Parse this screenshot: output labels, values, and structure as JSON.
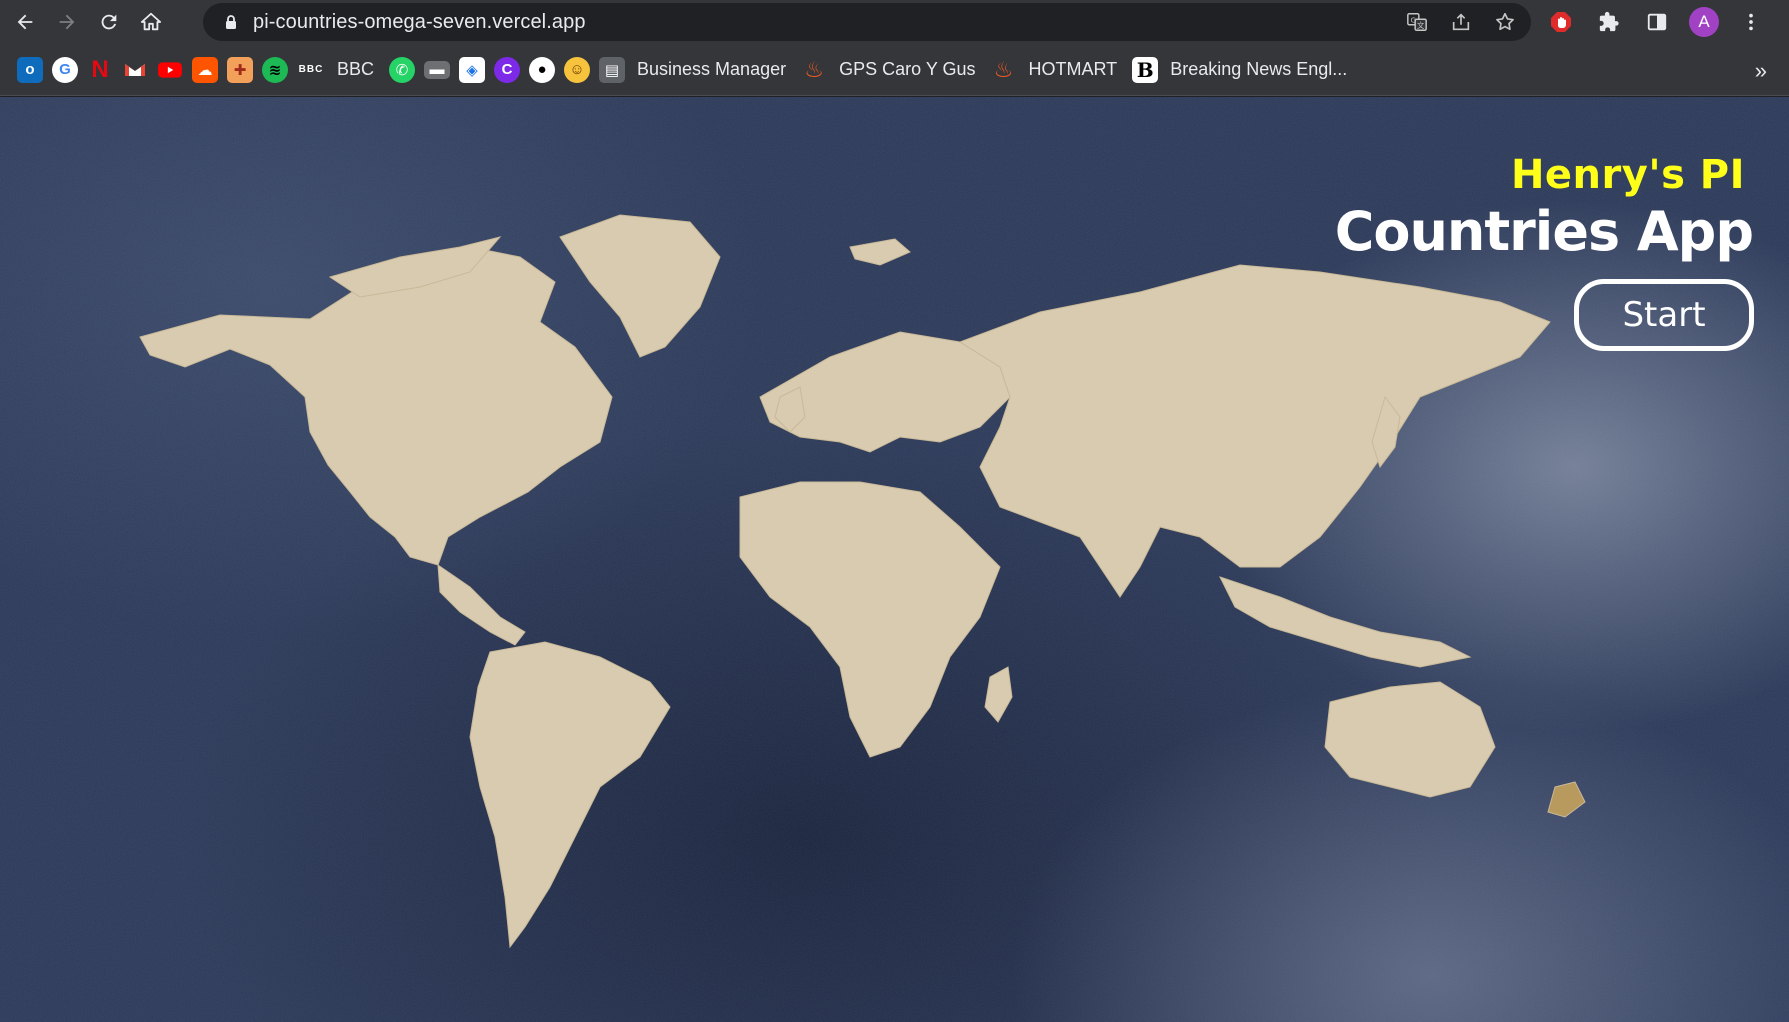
{
  "browser": {
    "url": "pi-countries-omega-seven.vercel.app",
    "avatar_letter": "A",
    "bookmarks": [
      {
        "icon": "outlook-icon",
        "label": ""
      },
      {
        "icon": "google-icon",
        "label": ""
      },
      {
        "icon": "netflix-icon",
        "label": ""
      },
      {
        "icon": "gmail-icon",
        "label": ""
      },
      {
        "icon": "youtube-icon",
        "label": ""
      },
      {
        "icon": "soundcloud-icon",
        "label": ""
      },
      {
        "icon": "crest-icon",
        "label": ""
      },
      {
        "icon": "spotify-icon",
        "label": ""
      },
      {
        "icon": "bbc-icon",
        "label": "BBC"
      },
      {
        "icon": "whatsapp-icon",
        "label": ""
      },
      {
        "icon": "box-icon",
        "label": ""
      },
      {
        "icon": "layers-icon",
        "label": ""
      },
      {
        "icon": "canva-icon",
        "label": ""
      },
      {
        "icon": "panda-icon",
        "label": ""
      },
      {
        "icon": "emoji-icon",
        "label": ""
      },
      {
        "icon": "business-manager-icon",
        "label": "Business Manager"
      },
      {
        "icon": "fire-icon",
        "label": "GPS Caro Y Gus"
      },
      {
        "icon": "hotmart-icon",
        "label": "HOTMART"
      },
      {
        "icon": "breaking-news-icon",
        "label": "Breaking News Engl..."
      }
    ],
    "more_label": "»"
  },
  "hero": {
    "kicker": "Henry's PI",
    "title": "Countries App",
    "start_label": "Start"
  },
  "colors": {
    "kicker": "#ffff1a",
    "title": "#ffffff",
    "land": "#d8cbb0",
    "ocean": "#2c3a5a"
  }
}
